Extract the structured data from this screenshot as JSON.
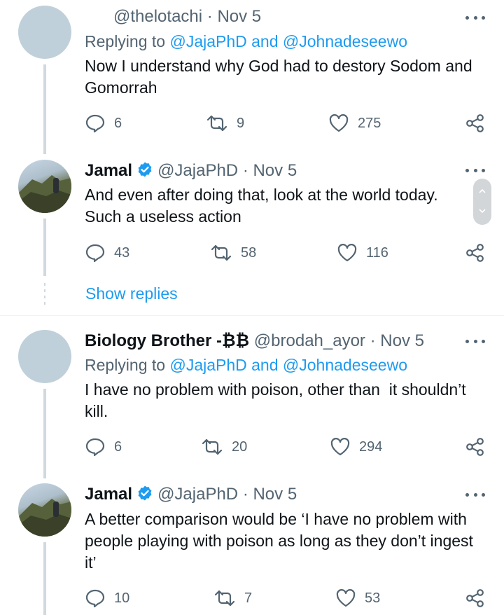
{
  "tweets": [
    {
      "handle": "@thelotachi",
      "date": "· Nov 5",
      "replying_prefix": "Replying to",
      "replying_to": "@JajaPhD and @Johnadeseewo",
      "text": "Now I understand why God had to destory Sodom and Gomorrah",
      "replies": "6",
      "retweets": "9",
      "likes": "275"
    },
    {
      "name": "Jamal",
      "handle": "@JajaPhD",
      "date": "· Nov 5",
      "text": "And even after doing that, look at the world today. Such a useless action",
      "replies": "43",
      "retweets": "58",
      "likes": "116"
    },
    {
      "name": "Biology Brother -₿₿",
      "handle": "@brodah_ayor",
      "date": "· Nov 5",
      "replying_prefix": "Replying to",
      "replying_to": "@JajaPhD and @Johnadeseewo",
      "text": "I have no problem with poison, other than  it shouldn’t kill.",
      "replies": "6",
      "retweets": "20",
      "likes": "294"
    },
    {
      "name": "Jamal",
      "handle": "@JajaPhD",
      "date": "· Nov 5",
      "text": "A better comparison would be ‘I have no problem with people playing with poison as long as they don’t ingest it’",
      "replies": "10",
      "retweets": "7",
      "likes": "53"
    }
  ],
  "show_replies": "Show replies",
  "colors": {
    "link": "#1d9bf0",
    "muted": "#536471",
    "text": "#0f1419",
    "verified": "#1d9bf0"
  }
}
